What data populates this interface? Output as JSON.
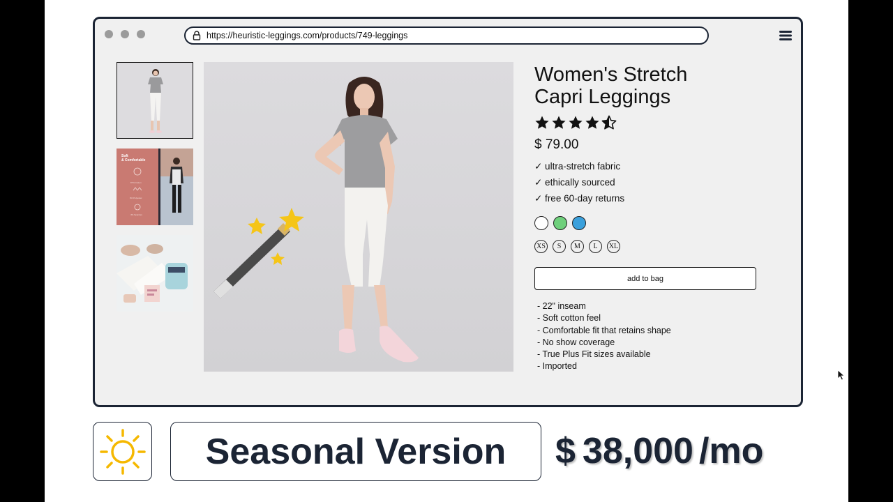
{
  "browser": {
    "url": "https://heuristic-leggings.com/products/749-leggings"
  },
  "product": {
    "title_line1": "Women's Stretch",
    "title_line2": "Capri Leggings",
    "rating": 4.5,
    "rating_max": 5,
    "price": "$ 79.00",
    "features": [
      "✓ ultra-stretch fabric",
      "✓ ethically sourced",
      "✓ free 60-day returns"
    ],
    "colors": [
      "#ffffff",
      "#6fd07c",
      "#3aa0dc"
    ],
    "sizes": [
      "XS",
      "S",
      "M",
      "L",
      "XL"
    ],
    "add_to_bag": "add to bag",
    "details": [
      "- 22\" inseam",
      "- Soft cotton feel",
      "- Comfortable fit that retains shape",
      "- No show coverage",
      "- True Plus Fit sizes available",
      "- Imported"
    ]
  },
  "thumbnail2": {
    "heading": "Soft\n& Comfortable",
    "lines": [
      "87% Cotton",
      "9% Polyester",
      "4% Spandex"
    ]
  },
  "slide": {
    "label": "Seasonal Version",
    "cost_prefix": "$",
    "cost_value": "38,000",
    "cost_suffix": "/mo",
    "icon": "sun-icon",
    "accent": "#f5b800",
    "text_color": "#1b2434"
  }
}
